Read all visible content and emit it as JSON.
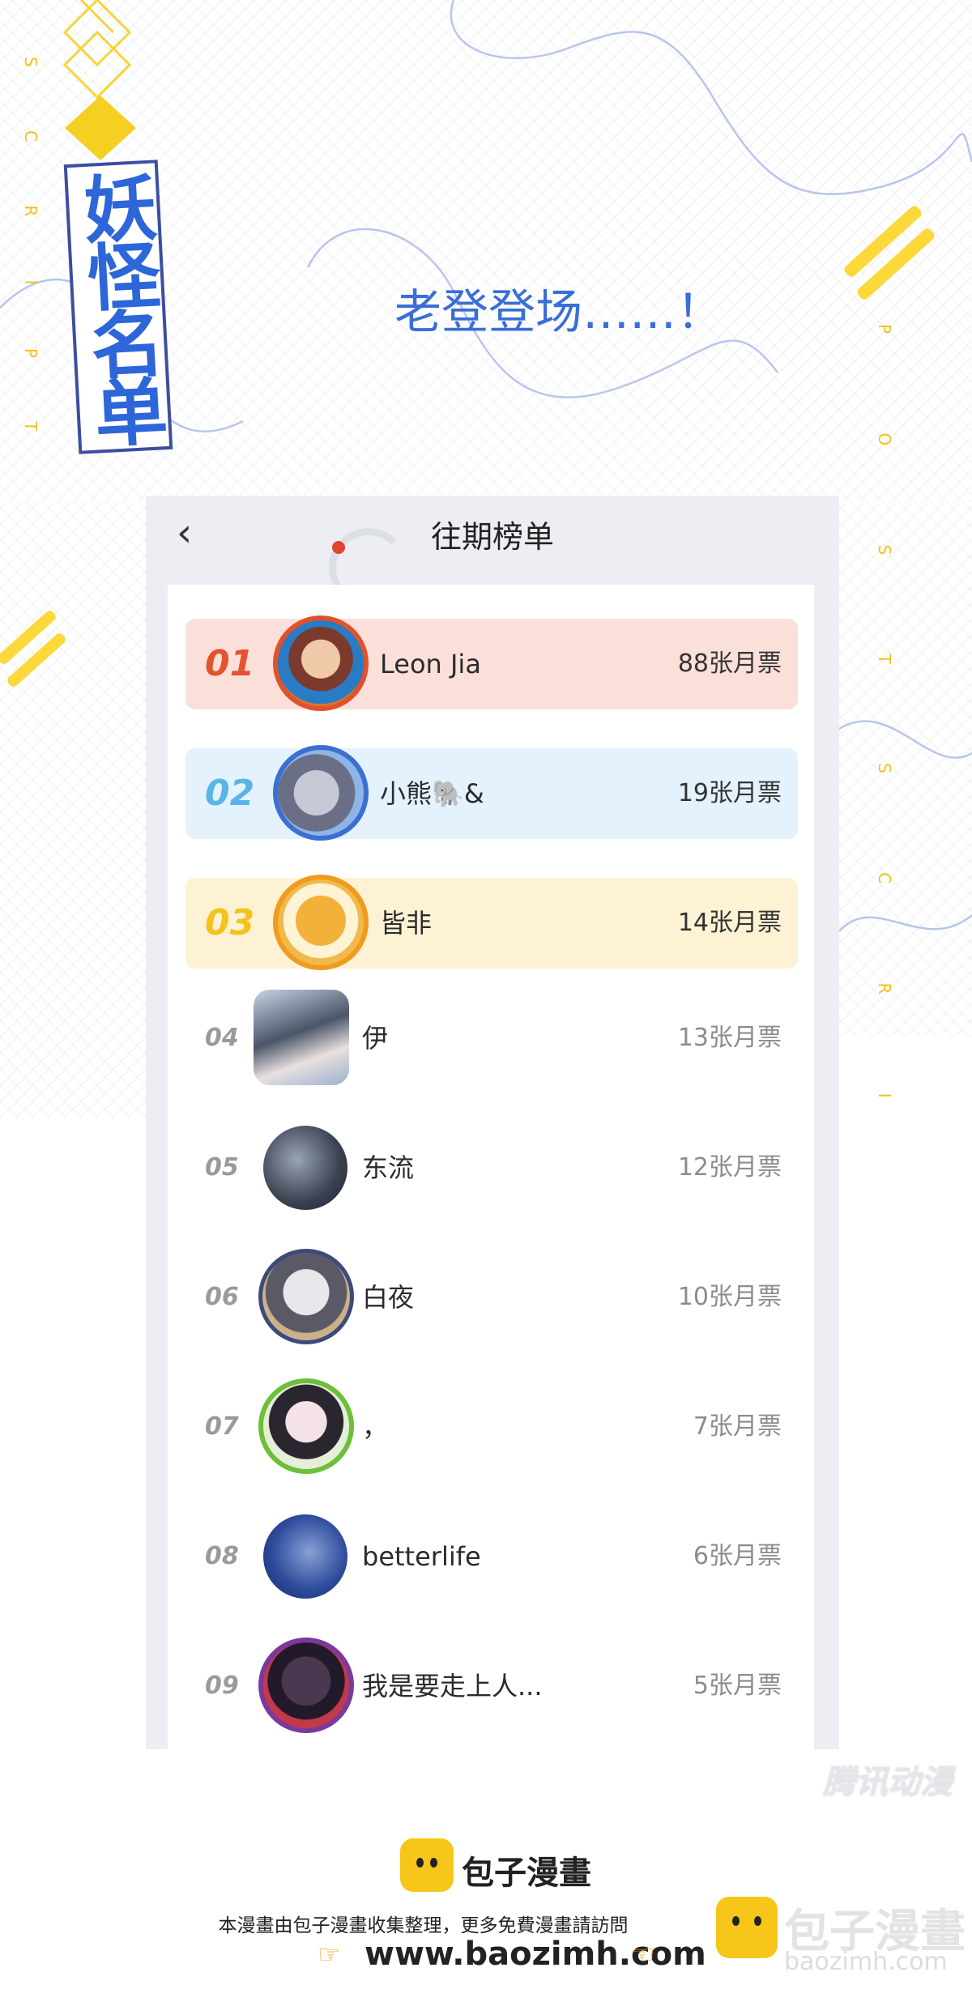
{
  "banner": {
    "logo_text": "妖怪名单",
    "headline": "老登登场……！",
    "side_left": "S C R I P T",
    "side_right": "P O S T S C R I"
  },
  "panel": {
    "title": "往期榜单",
    "back_icon": "chevron-left-icon"
  },
  "ranking": [
    {
      "rank": "01",
      "name": "Leon Jia",
      "votes": "88张月票",
      "color": "#e4522e",
      "bg": "#fbe0d9"
    },
    {
      "rank": "02",
      "name": "小熊🐘&",
      "votes": "19张月票",
      "color": "#5bb4e8",
      "bg": "#e3f2fd"
    },
    {
      "rank": "03",
      "name": "皆非",
      "votes": "14张月票",
      "color": "#f5c21c",
      "bg": "#fdf2d4"
    },
    {
      "rank": "04",
      "name": "伊",
      "votes": "13张月票"
    },
    {
      "rank": "05",
      "name": "东流",
      "votes": "12张月票"
    },
    {
      "rank": "06",
      "name": "白夜",
      "votes": "10张月票"
    },
    {
      "rank": "07",
      "name": "，",
      "votes": "7张月票"
    },
    {
      "rank": "08",
      "name": "betterlife",
      "votes": "6张月票"
    },
    {
      "rank": "09",
      "name": "我是要走上人...",
      "votes": "5张月票"
    }
  ],
  "watermark": "腾讯动漫",
  "footer": {
    "brand": "包子漫畫",
    "note": "本漫畫由包子漫畫收集整理，更多免費漫畫請訪問",
    "url": "www.baozimh.com",
    "corner_brand": "包子漫畫",
    "corner_url": "baozimh.com"
  }
}
